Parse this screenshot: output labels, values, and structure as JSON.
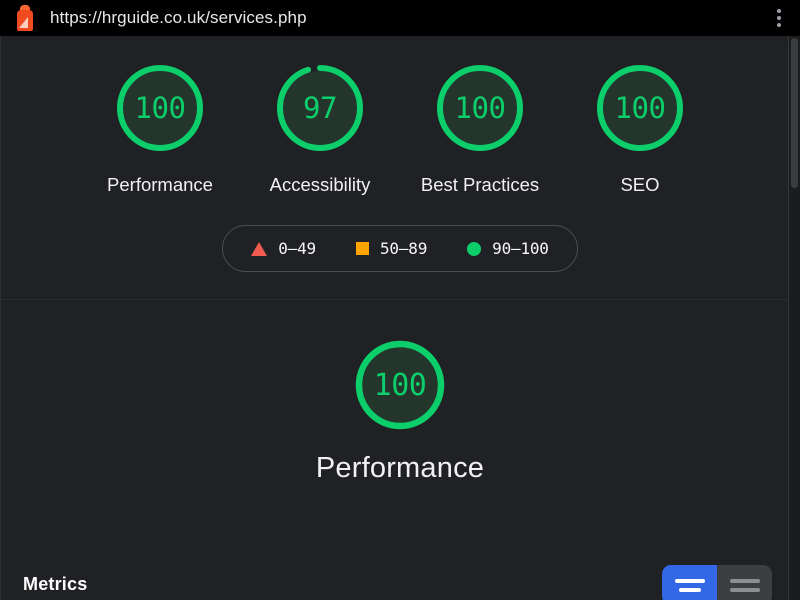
{
  "browser": {
    "url": "https://hrguide.co.uk/services.php",
    "logo_icon": "lighthouse-icon",
    "menu_icon": "kebab-menu-icon"
  },
  "report": {
    "scores": [
      {
        "label": "Performance",
        "value": "100",
        "score": 100,
        "color": "#0cce6b"
      },
      {
        "label": "Accessibility",
        "value": "97",
        "score": 97,
        "color": "#0cce6b"
      },
      {
        "label": "Best Practices",
        "value": "100",
        "score": 100,
        "color": "#0cce6b"
      },
      {
        "label": "SEO",
        "value": "100",
        "score": 100,
        "color": "#0cce6b"
      }
    ],
    "legend": [
      {
        "icon": "triangle-fail-icon",
        "label": "0–49",
        "color": "#f15b50"
      },
      {
        "icon": "square-average-icon",
        "label": "50–89",
        "color": "#ffa400"
      },
      {
        "icon": "circle-pass-icon",
        "label": "90–100",
        "color": "#0cce6b"
      }
    ],
    "category": {
      "value": "100",
      "score": 100,
      "title": "Performance",
      "color": "#0cce6b"
    },
    "metrics": {
      "heading": "Metrics",
      "toggle": {
        "selected": "list-view",
        "options": [
          "list-view",
          "table-view"
        ],
        "selected_color": "#3367e6",
        "unselected_color": "#3c3e41"
      }
    }
  }
}
